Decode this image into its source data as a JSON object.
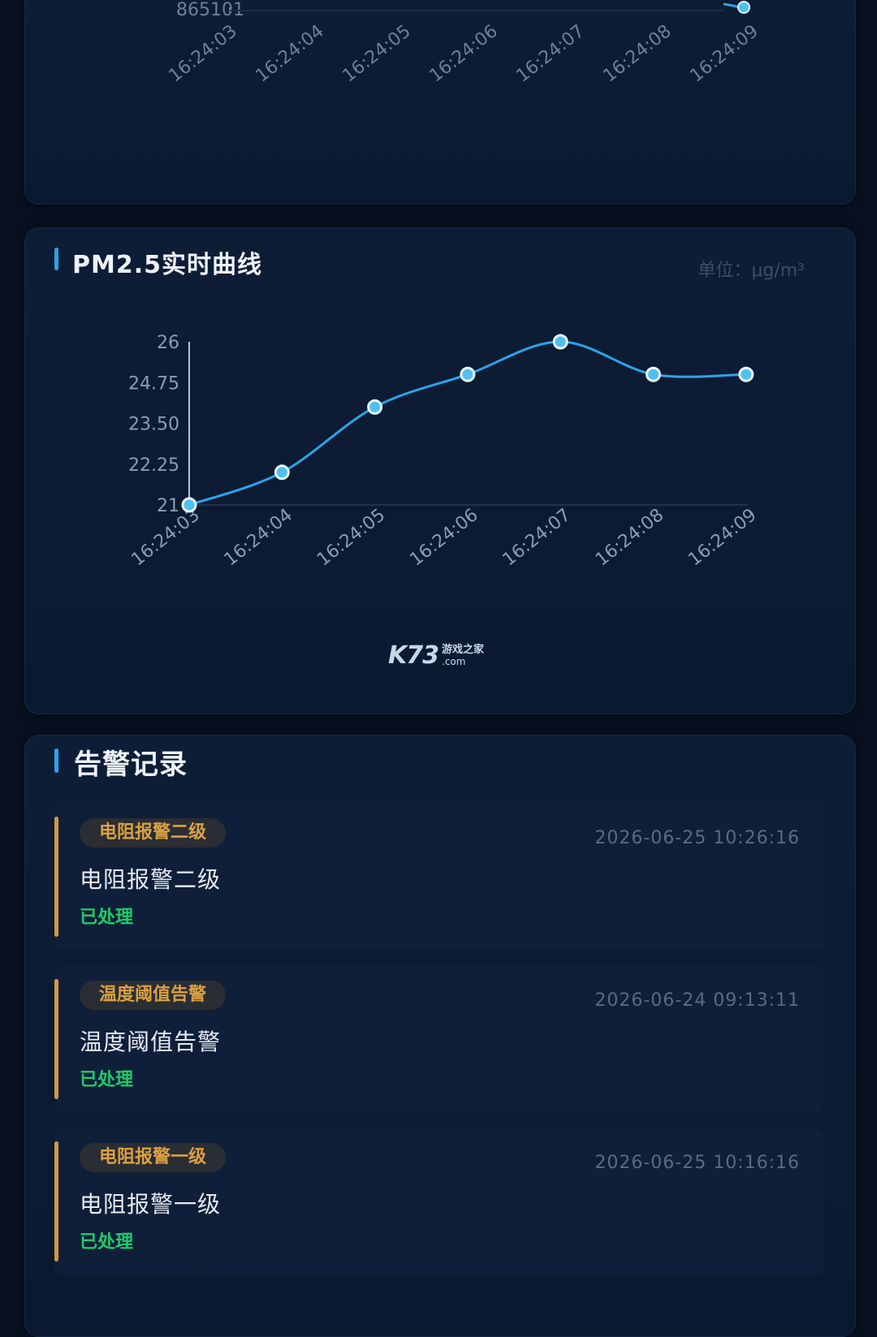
{
  "top_chart": {
    "y_label_visible": "865101",
    "x_labels": [
      "16:24:03",
      "16:24:04",
      "16:24:05",
      "16:24:06",
      "16:24:07",
      "16:24:08",
      "16:24:09"
    ]
  },
  "pm_card": {
    "title": "PM2.5实时曲线",
    "unit": "单位：μg/m³"
  },
  "chart_data": {
    "type": "line",
    "title": "PM2.5实时曲线",
    "x": [
      "16:24:03",
      "16:24:04",
      "16:24:05",
      "16:24:06",
      "16:24:07",
      "16:24:08",
      "16:24:09"
    ],
    "series": [
      {
        "values": [
          21,
          22,
          24,
          25,
          26,
          25,
          25
        ]
      }
    ],
    "y_ticks": [
      "26",
      "24.75",
      "23.50",
      "22.25",
      "21"
    ],
    "ylim": [
      21,
      26
    ],
    "line_color": "#2aa4ea",
    "grid": false
  },
  "watermark": {
    "logo": "K73",
    "cn": "游戏之家",
    "com": ".com"
  },
  "alarm_card": {
    "title": "告警记录",
    "items": [
      {
        "badge": "电阻报警二级",
        "time": "2026-06-25 10:26:16",
        "name": "电阻报警二级",
        "status": "已处理"
      },
      {
        "badge": "温度阈值告警",
        "time": "2026-06-24 09:13:11",
        "name": "温度阈值告警",
        "status": "已处理"
      },
      {
        "badge": "电阻报警一级",
        "time": "2026-06-25 10:16:16",
        "name": "电阻报警一级",
        "status": "已处理"
      }
    ]
  },
  "colors": {
    "accent": "#2aa4ea",
    "alarm_accent": "#d39a3f",
    "status_ok": "#1fca6a"
  }
}
